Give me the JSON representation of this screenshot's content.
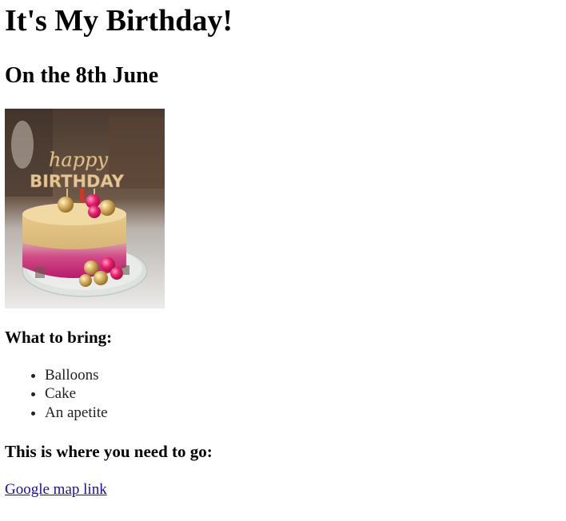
{
  "heading": "It's My Birthday!",
  "date": "On the 8th June",
  "cake_image": {
    "topper_line1": "happy",
    "topper_line2": "BIRTHDAY"
  },
  "bring": {
    "title": "What to bring:",
    "items": [
      "Balloons",
      "Cake",
      "An apetite"
    ]
  },
  "location": {
    "title": "This is where you need to go:",
    "link_text": "Google map link"
  },
  "colors": {
    "text": "#000000",
    "link": "#1a0dab",
    "list_text": "#222222"
  }
}
